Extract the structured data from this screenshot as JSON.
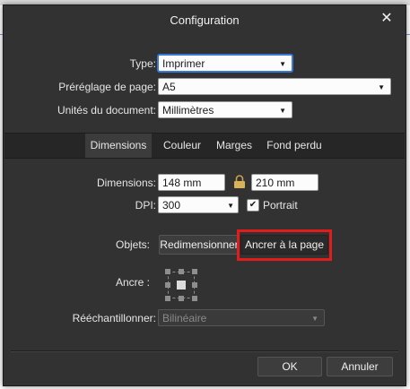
{
  "dialog": {
    "title": "Configuration",
    "close_glyph": "✕"
  },
  "form": {
    "type_label": "Type:",
    "type_value": "Imprimer",
    "preset_label": "Préréglage de page:",
    "preset_value": "A5",
    "units_label": "Unités du document:",
    "units_value": "Millimètres"
  },
  "tabs": [
    {
      "label": "Dimensions",
      "active": true
    },
    {
      "label": "Couleur",
      "active": false
    },
    {
      "label": "Marges",
      "active": false
    },
    {
      "label": "Fond perdu",
      "active": false
    }
  ],
  "dimensions": {
    "label": "Dimensions:",
    "width": "148 mm",
    "height": "210 mm",
    "dpi_label": "DPI:",
    "dpi_value": "300",
    "portrait_label": "Portrait",
    "portrait_checked": true
  },
  "objects": {
    "label": "Objets:",
    "resize_button": "Redimensionner",
    "anchor_button": "Ancrer à la page",
    "anchor_label": "Ancre :",
    "resample_label": "Rééchantillonner:",
    "resample_value": "Bilinéaire"
  },
  "footer": {
    "ok": "OK",
    "cancel": "Annuler"
  },
  "icons": {
    "lock": "padlock-icon",
    "dropdown": "chevron-down-icon",
    "check": "✔"
  },
  "colors": {
    "dialog_bg": "#323232",
    "tab_bar_bg": "#262626",
    "highlight": "#e21b1b",
    "focus": "#3a78d6"
  }
}
